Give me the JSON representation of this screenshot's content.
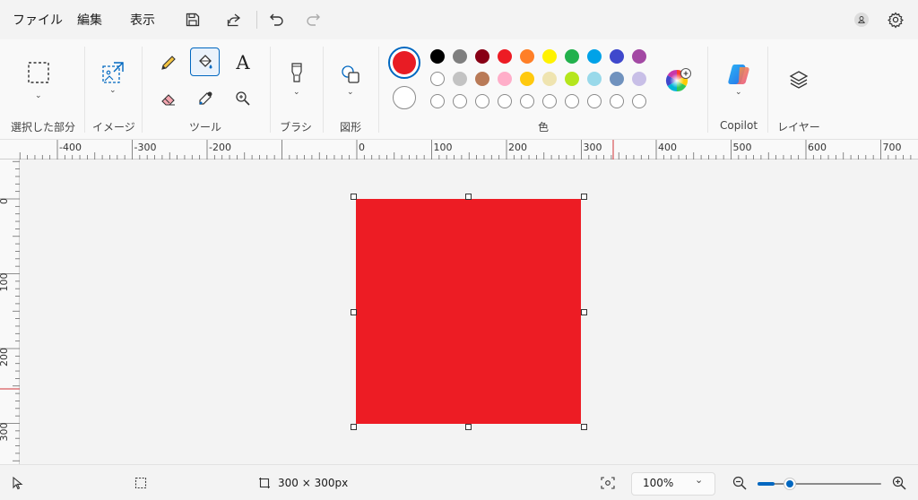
{
  "menu": {
    "file": "ファイル",
    "edit": "編集",
    "view": "表示"
  },
  "ribbon": {
    "selection_label": "選択した部分",
    "image_label": "イメージ",
    "tools_label": "ツール",
    "brushes_label": "ブラシ",
    "shapes_label": "図形",
    "colors_label": "色",
    "copilot_label": "Copilot",
    "layers_label": "レイヤー"
  },
  "colors": {
    "primary": "#e81c24",
    "secondary": "#ffffff",
    "palette_row1": [
      "#000000",
      "#7f7f7f",
      "#880015",
      "#ed1c24",
      "#ff7f27",
      "#fff200",
      "#22b14c",
      "#00a2e8",
      "#3f48cc",
      "#a349a4"
    ],
    "palette_row2": [
      "#ffffff",
      "#c3c3c3",
      "#b97a57",
      "#ffaec9",
      "#ffc90e",
      "#efe4b0",
      "#b5e61d",
      "#99d9ea",
      "#7092be",
      "#c8bfe7"
    ],
    "custom_slots": 10,
    "accent": "#0067c0"
  },
  "rulers": {
    "h_labels": [
      "-400",
      "-300",
      "-200",
      "0",
      "100",
      "200",
      "300",
      "400",
      "500",
      "600",
      "700"
    ],
    "v_labels": [
      "0",
      "100",
      "200",
      "300"
    ]
  },
  "canvas": {
    "fill": "#ed1c24"
  },
  "status": {
    "canvas_size": "300 × 300px",
    "zoom": "100%",
    "zoom_level": 0.25
  }
}
